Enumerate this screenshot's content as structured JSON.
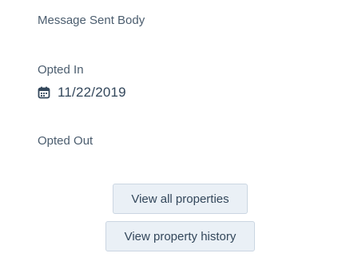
{
  "properties": {
    "message_sent_body": {
      "label": "Message Sent Body"
    },
    "opted_in": {
      "label": "Opted In",
      "value": "11/22/2019",
      "icon": "calendar-icon"
    },
    "opted_out": {
      "label": "Opted Out"
    }
  },
  "actions": {
    "view_all_label": "View all properties",
    "view_history_label": "View property history"
  },
  "colors": {
    "text": "#33475b",
    "button_bg": "#eaf0f6",
    "button_border": "#cbd6e2"
  }
}
